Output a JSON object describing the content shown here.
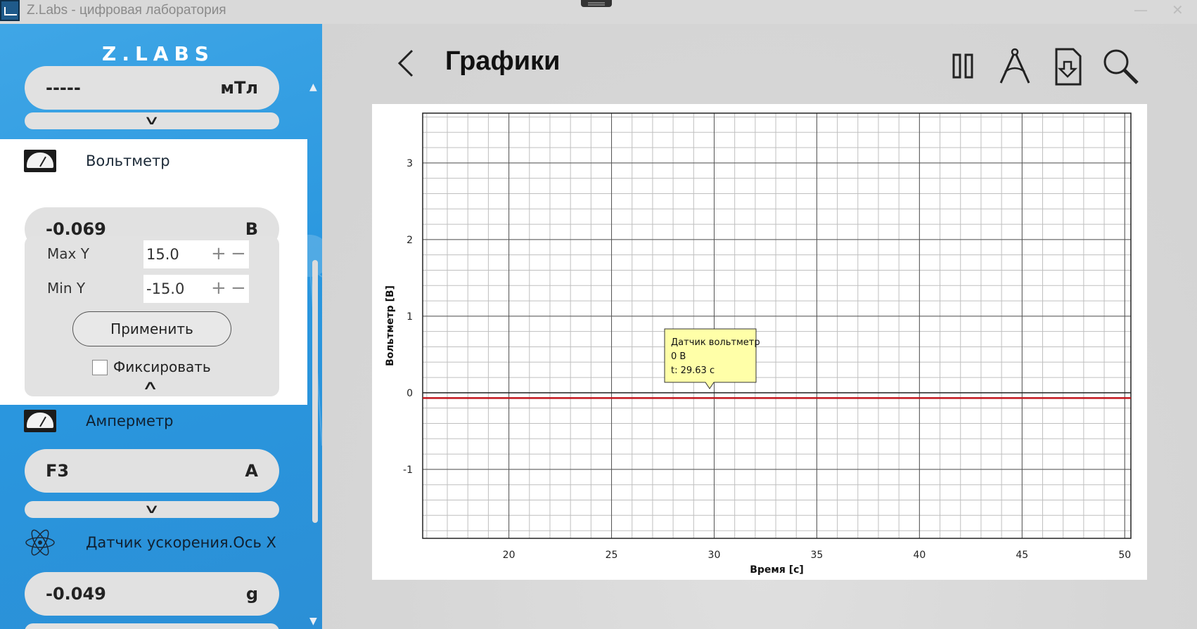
{
  "window": {
    "title": "Z.Labs - цифровая лаборатория",
    "minimize": "—",
    "close": "✕"
  },
  "sidebar": {
    "logo": "Z.LABS",
    "top_sensor": {
      "value": "-----",
      "unit": "мТл"
    },
    "voltmeter": {
      "name": "Вольтметр",
      "value": "-0.069",
      "unit": "В",
      "max_y_label": "Max Y",
      "max_y_value": "15.0",
      "min_y_label": "Min Y",
      "min_y_value": "-15.0",
      "apply_label": "Применить",
      "fix_label": "Фиксировать",
      "fixed": false
    },
    "ammeter": {
      "name": "Амперметр",
      "value": "F3",
      "unit": "A"
    },
    "accel": {
      "name": "Датчик ускорения.Ось X",
      "value": "-0.049",
      "unit": "g"
    }
  },
  "main": {
    "title": "Графики",
    "tools": [
      "pause-icon",
      "compass-icon",
      "download-file-icon",
      "search-icon"
    ]
  },
  "tooltip": {
    "line1": "Датчик вольтметр",
    "line2": "0 В",
    "line3": "t: 29.63 с"
  },
  "chart_data": {
    "type": "line",
    "xlabel": "Время [с]",
    "ylabel": "Вольтметр [В]",
    "xlim": [
      15.8,
      50.3
    ],
    "ylim": [
      -1.9,
      3.65
    ],
    "x_ticks": [
      20,
      25,
      30,
      35,
      40,
      45,
      50
    ],
    "y_ticks": [
      -1,
      0,
      1,
      2,
      3
    ],
    "grid": true,
    "series": [
      {
        "x": [
          15.8,
          50.3
        ],
        "y": [
          -0.069,
          -0.069
        ],
        "color": "#c0141c"
      }
    ],
    "zero_line_color": "#222222"
  }
}
